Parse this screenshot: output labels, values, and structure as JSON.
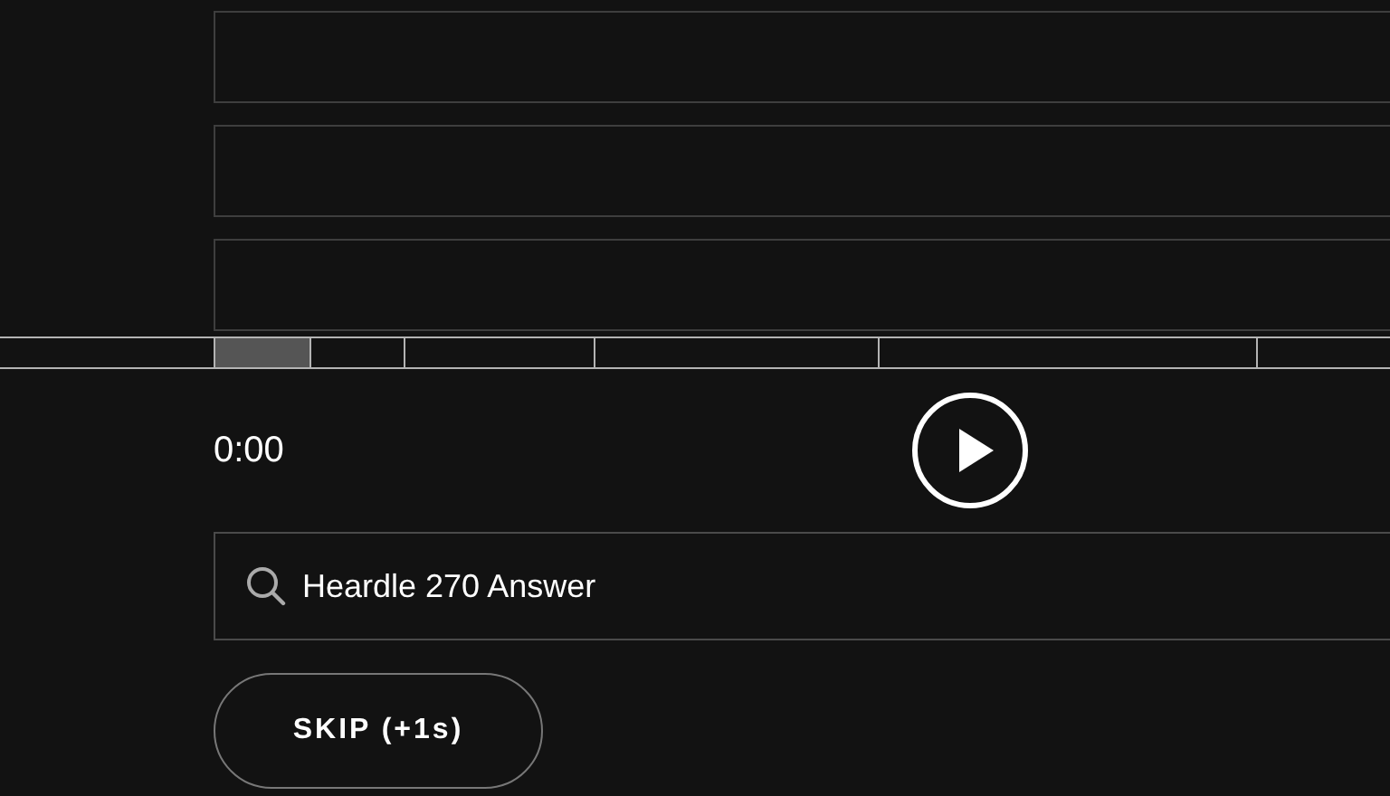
{
  "progress": {
    "segments": [
      {
        "unlocked": true
      },
      {
        "unlocked": false
      },
      {
        "unlocked": false
      },
      {
        "unlocked": false
      },
      {
        "unlocked": false
      },
      {
        "unlocked": false
      }
    ]
  },
  "player": {
    "time": "0:00",
    "playing": false
  },
  "search": {
    "value": "Heardle 270 Answer"
  },
  "skip_button": {
    "label": "SKIP (+1s)"
  }
}
